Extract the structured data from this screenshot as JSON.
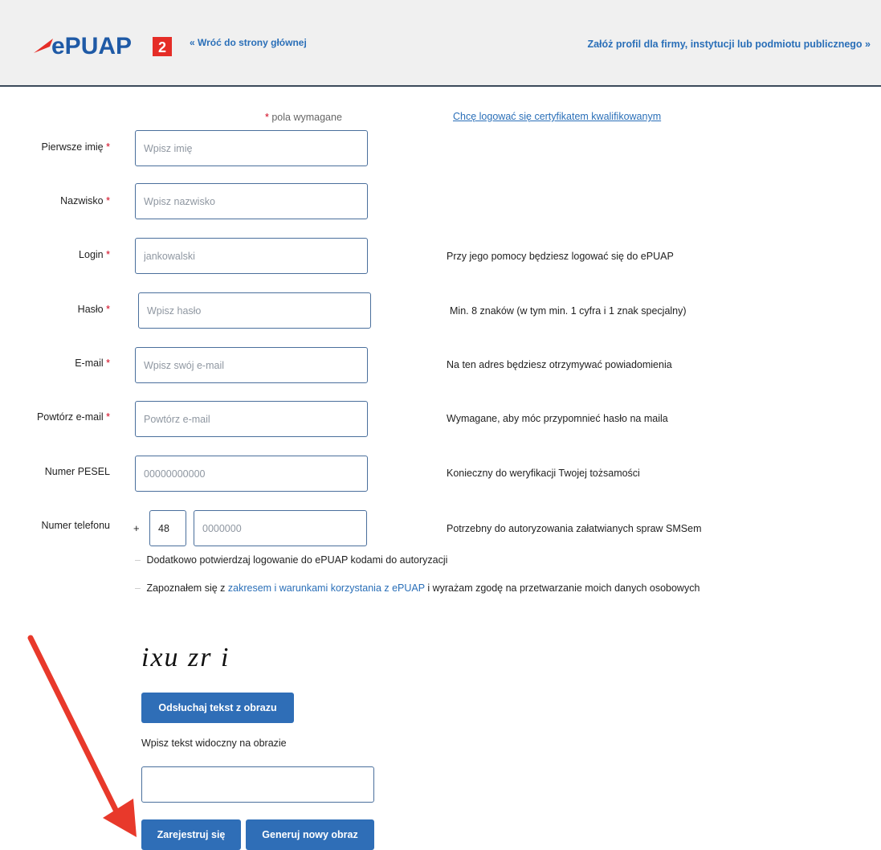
{
  "header": {
    "logo_text": "ePUAP",
    "logo_badge": "2",
    "back_link": "« Wróć do strony głównej",
    "profile_link": "Załóż profil dla firmy, instytucji lub podmiotu publicznego »"
  },
  "form": {
    "required_note": "pola wymagane",
    "required_star": "*",
    "cert_link": "Chcę logować się certyfikatem kwalifikowanym",
    "fields": {
      "first_name": {
        "label": "Pierwsze imię",
        "placeholder": "Wpisz imię",
        "value": "",
        "hint": ""
      },
      "last_name": {
        "label": "Nazwisko",
        "placeholder": "Wpisz nazwisko",
        "value": "",
        "hint": ""
      },
      "login": {
        "label": "Login",
        "placeholder": "jankowalski",
        "value": "",
        "hint": "Przy jego pomocy będziesz logować się do ePUAP"
      },
      "password": {
        "label": "Hasło",
        "placeholder": "Wpisz hasło",
        "value": "",
        "hint": "Min. 8 znaków (w tym min. 1 cyfra i 1 znak specjalny)"
      },
      "email": {
        "label": "E-mail",
        "placeholder": "Wpisz swój e-mail",
        "value": "",
        "hint": "Na ten adres będziesz otrzymywać powiadomienia"
      },
      "email_repeat": {
        "label": "Powtórz e-mail",
        "placeholder": "Powtórz e-mail",
        "value": "",
        "hint": "Wymagane, aby móc przypomnieć hasło na maila"
      },
      "pesel": {
        "label": "Numer PESEL",
        "placeholder": "00000000000",
        "value": "",
        "hint": "Konieczny do weryfikacji Twojej tożsamości"
      },
      "phone": {
        "label": "Numer telefonu",
        "prefix_sign": "+",
        "country_code": "48",
        "placeholder": "0000000",
        "value": "",
        "hint": "Potrzebny do autoryzowania załatwianych spraw SMSem"
      }
    },
    "checkbox_2fa": "Dodatkowo potwierdzaj logowanie do ePUAP kodami do autoryzacji",
    "checkbox_terms": {
      "before": "Zapoznałem się z ",
      "link": "zakresem i warunkami korzystania z ePUAP",
      "after": " i wyrażam zgodę na przetwarzanie moich danych osobowych"
    },
    "checkbox_mark": "–"
  },
  "captcha": {
    "image_text": "ixu zr i",
    "listen_button": "Odsłuchaj tekst z obrazu",
    "input_label": "Wpisz tekst widoczny na obrazie",
    "input_value": ""
  },
  "actions": {
    "register_button": "Zarejestruj się",
    "new_image_button": "Generuj nowy obraz"
  },
  "colors": {
    "accent": "#2f6eb7",
    "link": "#2a6fb8",
    "required": "#d0021b",
    "arrow": "#e8392b",
    "logo_red": "#e52d27",
    "logo_blue": "#1f5aa6"
  }
}
